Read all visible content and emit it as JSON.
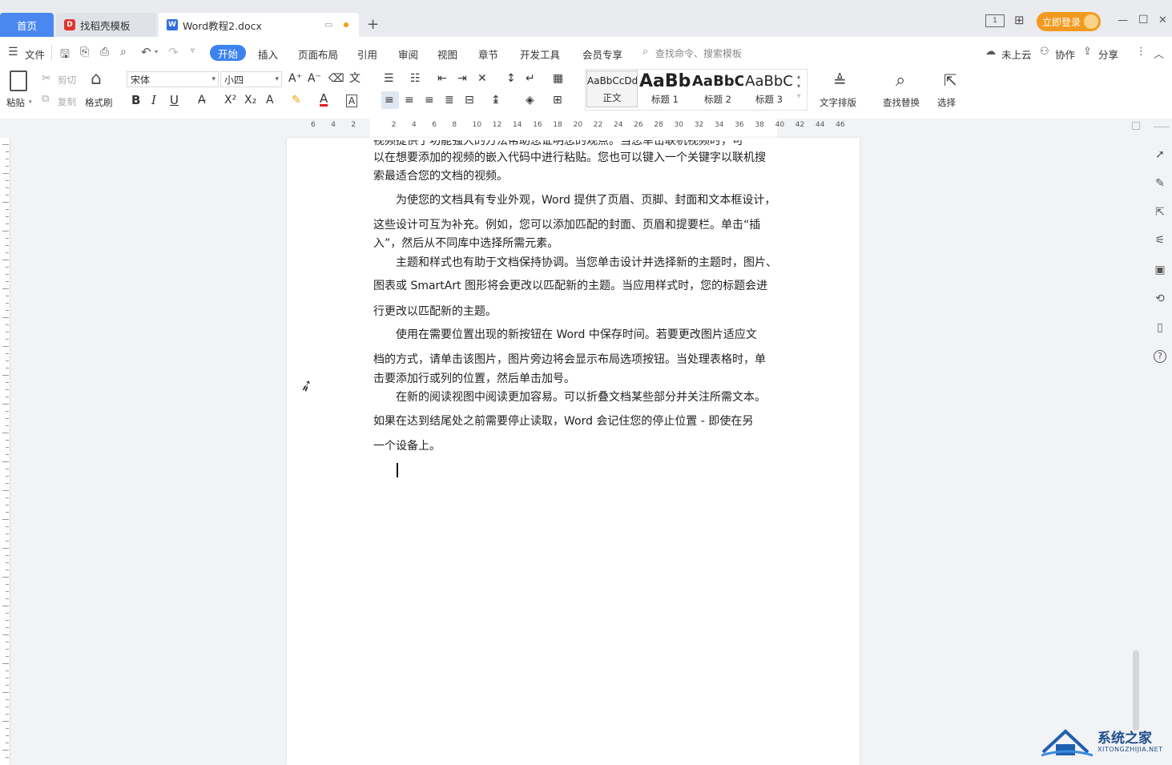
{
  "tabs": {
    "home": "首页",
    "template": "找稻壳模板",
    "doc": "Word教程2.docx",
    "new_tab": "+"
  },
  "window": {
    "login": "立即登录",
    "minimize": "—",
    "maximize": "☐",
    "close": "✕"
  },
  "menu": {
    "file": "文件",
    "items": [
      "开始",
      "插入",
      "页面布局",
      "引用",
      "审阅",
      "视图",
      "章节",
      "开发工具",
      "会员专享"
    ],
    "search_placeholder": "查找命令、搜索模板",
    "cloud": "未上云",
    "collab": "协作",
    "share": "分享"
  },
  "ribbon": {
    "paste": "粘贴",
    "cut": "剪切",
    "copy": "复制",
    "format_painter": "格式刷",
    "font": "宋体",
    "size": "小四",
    "style_previews": [
      "AaBbCcDd",
      "AaBb",
      "AaBbC",
      "AaBbC"
    ],
    "styles": [
      "正文",
      "标题 1",
      "标题 2",
      "标题 3"
    ],
    "text_layout": "文字排版",
    "find_replace": "查找替换",
    "select": "选择"
  },
  "ruler": {
    "ticks": [
      "6",
      "4",
      "2",
      "",
      "2",
      "4",
      "6",
      "8",
      "10",
      "12",
      "14",
      "16",
      "18",
      "20",
      "22",
      "24",
      "26",
      "28",
      "30",
      "32",
      "34",
      "36",
      "38",
      "40",
      "42",
      "44",
      "46"
    ]
  },
  "document": {
    "lines": [
      "视频提供了功能强大的方法帮助您证明您的观点。当您单击联机视频时，可",
      "以在想要添加的视频的嵌入代码中进行粘贴。您也可以键入一个关键字以联机搜",
      "索最适合您的文档的视频。",
      "为使您的文档具有专业外观，Word 提供了页眉、页脚、封面和文本框设计，",
      "这些设计可互为补充。例如，您可以添加匹配的封面、页眉和提要栏。单击“插",
      "入”，然后从不同库中选择所需元素。",
      "主题和样式也有助于文档保持协调。当您单击设计并选择新的主题时，图片、",
      "图表或 SmartArt 图形将会更改以匹配新的主题。当应用样式时，您的标题会进",
      "行更改以匹配新的主题。",
      "使用在需要位置出现的新按钮在 Word 中保存时间。若要更改图片适应文",
      "档的方式，请单击该图片，图片旁边将会显示布局选项按钮。当处理表格时，单",
      "击要添加行或列的位置，然后单击加号。",
      "在新的阅读视图中阅读更加容易。可以折叠文档某些部分并关注所需文本。",
      "如果在达到结尾处之前需要停止读取，Word 会记住您的停止位置 - 即使在另",
      "一个设备上。"
    ]
  },
  "watermark": {
    "title": "系统之家",
    "subtitle": "XITONGZHIJIA.NET"
  }
}
